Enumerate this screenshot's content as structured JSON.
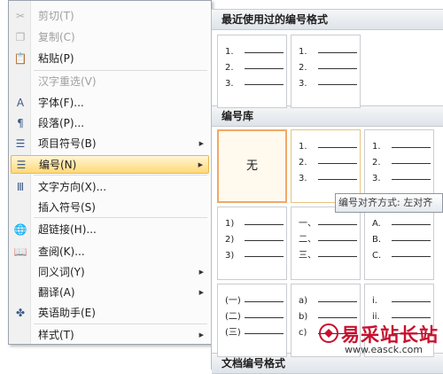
{
  "context_menu": {
    "items": [
      {
        "icon": "scissors-icon",
        "glyph": "✂",
        "label": "剪切(T)",
        "disabled": true
      },
      {
        "icon": "copy-icon",
        "glyph": "❐",
        "label": "复制(C)",
        "disabled": true
      },
      {
        "icon": "paste-icon",
        "glyph": "📋",
        "label": "粘贴(P)",
        "disabled": false
      },
      {
        "icon": "",
        "glyph": "",
        "label": "汉字重选(V)",
        "disabled": true
      },
      {
        "icon": "font-icon",
        "glyph": "A",
        "label": "字体(F)...",
        "disabled": false
      },
      {
        "icon": "paragraph-icon",
        "glyph": "¶",
        "label": "段落(P)...",
        "disabled": false
      },
      {
        "icon": "bullets-icon",
        "glyph": "☰",
        "label": "项目符号(B)",
        "disabled": false,
        "submenu": true
      },
      {
        "icon": "numbering-icon",
        "glyph": "☰",
        "label": "编号(N)",
        "disabled": false,
        "submenu": true,
        "highlighted": true
      },
      {
        "icon": "text-direction-icon",
        "glyph": "Ⅲ",
        "label": "文字方向(X)...",
        "disabled": false
      },
      {
        "icon": "",
        "glyph": "",
        "label": "插入符号(S)",
        "disabled": false
      },
      {
        "icon": "hyperlink-icon",
        "glyph": "🌐",
        "label": "超链接(H)...",
        "disabled": false
      },
      {
        "icon": "lookup-icon",
        "glyph": "📖",
        "label": "查阅(K)...",
        "disabled": false
      },
      {
        "icon": "",
        "glyph": "",
        "label": "同义词(Y)",
        "disabled": false,
        "submenu": true
      },
      {
        "icon": "",
        "glyph": "",
        "label": "翻译(A)",
        "disabled": false,
        "submenu": true
      },
      {
        "icon": "english-assistant-icon",
        "glyph": "✤",
        "label": "英语助手(E)",
        "disabled": false
      },
      {
        "icon": "",
        "glyph": "",
        "label": "样式(T)",
        "disabled": false,
        "submenu": true
      }
    ],
    "submenu_arrow": "▶"
  },
  "numbering_panel": {
    "recent_header": "最近使用过的编号格式",
    "library_header": "编号库",
    "document_header": "文档编号格式",
    "recent_tiles": [
      {
        "markers": [
          "1.",
          "2.",
          "3."
        ]
      },
      {
        "markers": [
          "1.",
          "2.",
          "3."
        ]
      }
    ],
    "library_tiles": [
      {
        "none_label": "无",
        "selected": true
      },
      {
        "markers": [
          "1.",
          "2.",
          "3."
        ],
        "hover": true
      },
      {
        "markers": [
          "1.",
          "2.",
          "3."
        ]
      },
      {
        "markers": [
          "1)",
          "2)",
          "3)"
        ]
      },
      {
        "markers": [
          "一、",
          "二、",
          "三、"
        ]
      },
      {
        "markers": [
          "A.",
          "B.",
          "C."
        ]
      },
      {
        "markers": [
          "(一)",
          "(二)",
          "(三)"
        ]
      },
      {
        "markers": [
          "a)",
          "b)",
          "c)"
        ]
      },
      {
        "markers": [
          "i.",
          "ii.",
          ""
        ]
      }
    ]
  },
  "tooltip": {
    "text": "编号对齐方式: 左对齐"
  },
  "watermark": {
    "title": "易采站长站",
    "url": "www.easck.com"
  }
}
